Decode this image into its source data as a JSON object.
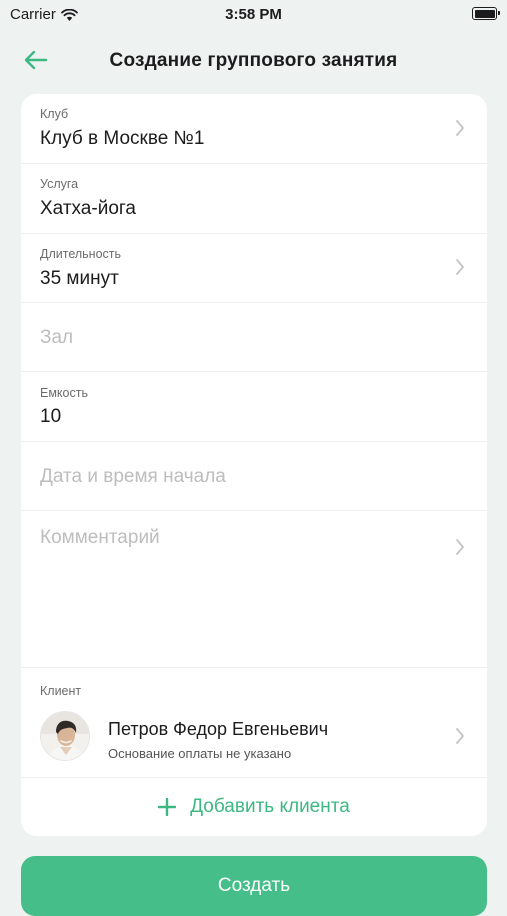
{
  "status_bar": {
    "carrier": "Carrier",
    "time": "3:58 PM"
  },
  "nav": {
    "title": "Создание группового занятия"
  },
  "form": {
    "club": {
      "label": "Клуб",
      "value": "Клуб в Москве №1"
    },
    "service": {
      "label": "Услуга",
      "value": "Хатха-йога"
    },
    "duration": {
      "label": "Длительность",
      "value": "35 минут"
    },
    "hall": {
      "placeholder": "Зал"
    },
    "capacity": {
      "label": "Емкость",
      "value": "10"
    },
    "start": {
      "placeholder": "Дата и время начала"
    },
    "comment": {
      "placeholder": "Комментарий"
    },
    "client_section": {
      "label": "Клиент"
    },
    "clients": [
      {
        "name": "Петров Федор Евгеньевич",
        "subtitle": "Основание оплаты не указано"
      }
    ],
    "add_client_label": "Добавить клиента"
  },
  "create_button": "Создать",
  "colors": {
    "accent": "#45be8a",
    "background": "#eef2f0"
  }
}
